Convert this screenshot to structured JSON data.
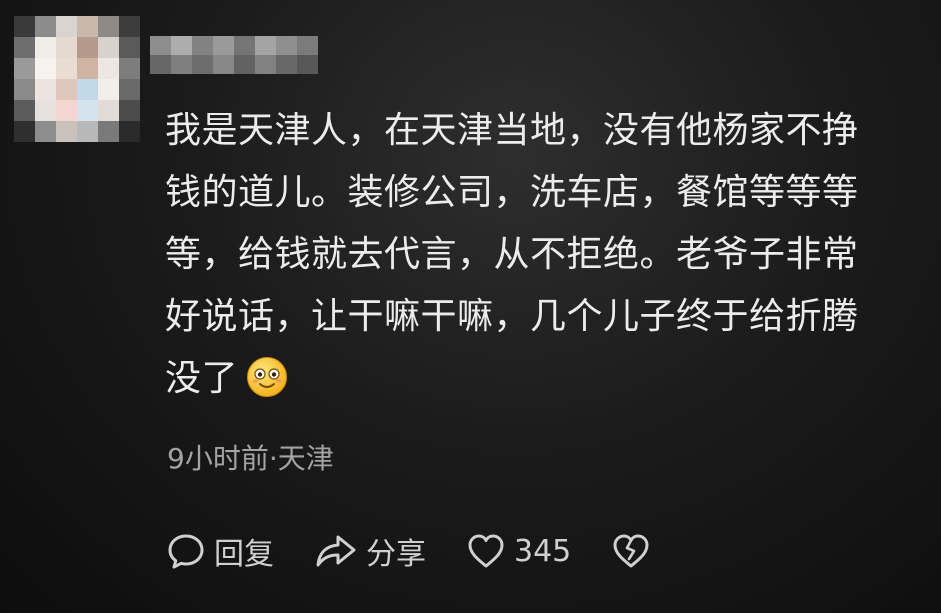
{
  "comment": {
    "lines": [
      "我是天津人，在天津当地，没有他杨家不挣",
      "钱的道儿。装修公司，洗车店，餐馆等等等",
      "等，给钱就去代言，从不拒绝。老爷子非常",
      "好说话，让干嘛干嘛，几个儿子终于给折腾",
      "没了"
    ],
    "emoji": "smiling-face-emoji"
  },
  "meta": {
    "time_location": "9小时前·天津"
  },
  "actions": {
    "reply_label": "回复",
    "share_label": "分享",
    "like_count": "345"
  },
  "icons": {
    "reply": "comment-bubble-icon",
    "share": "share-arrow-icon",
    "like": "heart-icon",
    "dislike": "broken-heart-icon"
  },
  "colors": {
    "background": "#1b1b1b",
    "text": "#ececec",
    "meta": "#a3a3a3",
    "icon": "#d0d0d0"
  }
}
